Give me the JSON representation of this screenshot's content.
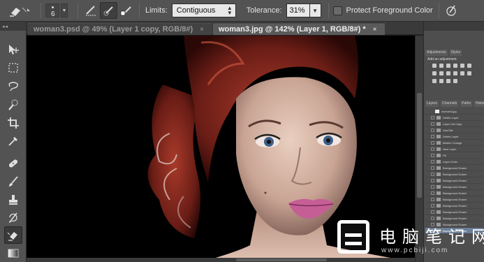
{
  "options_bar": {
    "brush_size": "6",
    "limits_label": "Limits:",
    "limits_value": "Contiguous",
    "tolerance_label": "Tolerance:",
    "tolerance_value": "31%",
    "protect_label": "Protect Foreground Color",
    "protect_checked": false
  },
  "tabs": [
    {
      "label": "woman3.psd @ 49% (Layer 1 copy, RGB/8#)",
      "close": "×",
      "active": false
    },
    {
      "label": "woman3.jpg @ 142% (Layer 1, RGB/8#) *",
      "close": "×",
      "active": true
    }
  ],
  "tools": [
    "move-tool",
    "marquee-tool",
    "lasso-tool",
    "quick-selection-tool",
    "crop-tool",
    "eyedropper-tool",
    "spot-healing-tool",
    "brush-tool",
    "clone-stamp-tool",
    "history-brush-tool",
    "background-eraser-tool",
    "gradient-tool"
  ],
  "active_tool": "background-eraser-tool",
  "right_panel": {
    "adjustments_tabs": [
      "Adjustments",
      "Styles"
    ],
    "adjustments_label": "Add an adjustment",
    "layer_tabs": [
      "Layers",
      "Channels",
      "Paths",
      "History"
    ],
    "history_snapshot": "woman3.jpg",
    "history_items": [
      "Delete Layer",
      "Layer Via Copy",
      "Hue/Sat",
      "Delete Layer",
      "Master Change",
      "New Layer",
      "Fill",
      "Layer Order",
      "Background Eraser",
      "Background Eraser",
      "Background Eraser",
      "Background Eraser",
      "Background Eraser",
      "Background Eraser",
      "Background Eraser",
      "Background Eraser",
      "Background Eraser",
      "Background Eraser",
      "Background Eraser"
    ],
    "history_selected_index": 18
  },
  "watermark": {
    "title": "电脑笔记网",
    "url": "www.pcbiji.com"
  },
  "colors": {
    "chrome": "#535353",
    "canvas": "#000000",
    "history_selected": "#6b7f97"
  }
}
